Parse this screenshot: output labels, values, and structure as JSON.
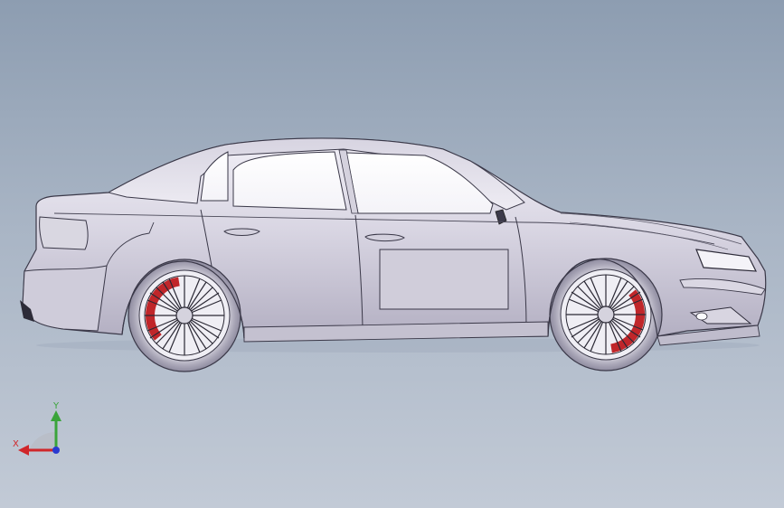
{
  "view": {
    "background_top": "#8d9db1",
    "background_bottom": "#c2cad6",
    "model": "sedan-side-view"
  },
  "triad": {
    "x_label": "X",
    "y_label": "Y",
    "x_color": "#d0262a",
    "y_color": "#3aa43a",
    "z_color": "#2a3ad0"
  },
  "car": {
    "body_color": "#e2e0ea",
    "shadow_color": "#b9b6c7",
    "caliper_color": "#c0262a"
  }
}
